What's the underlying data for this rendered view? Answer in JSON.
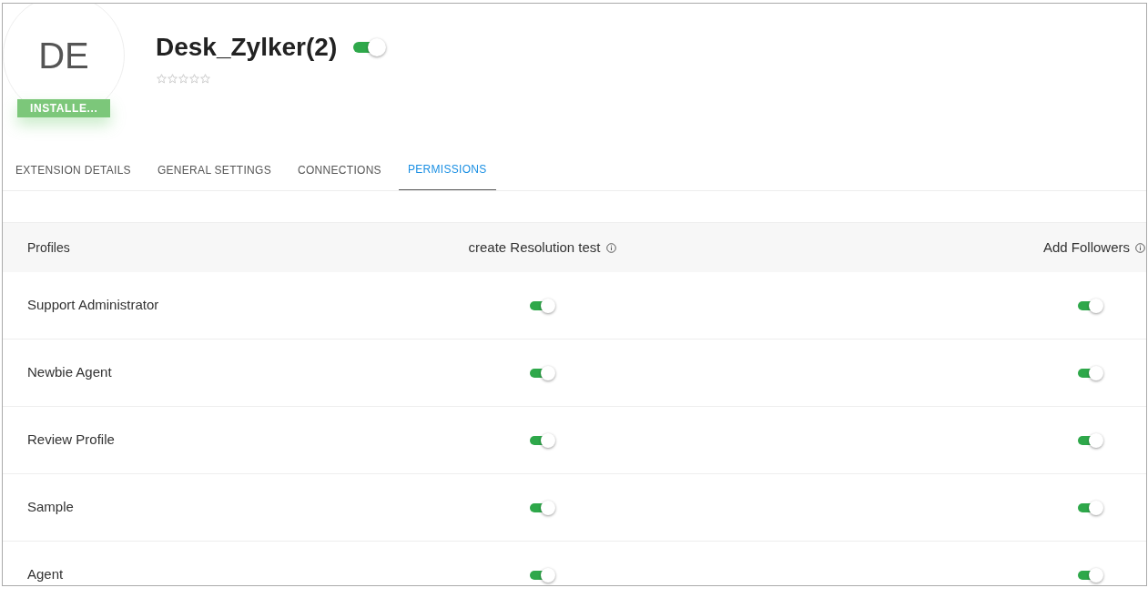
{
  "extension": {
    "initials": "DE",
    "ribbon": "INSTALLE...",
    "name": "Desk_Zylker(2)",
    "enabled": true,
    "stars": 0
  },
  "tabs": [
    {
      "label": "EXTENSION DETAILS",
      "selected": false
    },
    {
      "label": "GENERAL SETTINGS",
      "selected": false
    },
    {
      "label": "CONNECTIONS",
      "selected": false
    },
    {
      "label": "PERMISSIONS",
      "selected": true
    }
  ],
  "table": {
    "columns": [
      "Profiles",
      "create Resolution test",
      "Add Followers"
    ],
    "rows": [
      {
        "profile": "Support Administrator",
        "permissions": [
          true,
          true
        ]
      },
      {
        "profile": "Newbie Agent",
        "permissions": [
          true,
          true
        ]
      },
      {
        "profile": "Review Profile",
        "permissions": [
          true,
          true
        ]
      },
      {
        "profile": "Sample",
        "permissions": [
          true,
          true
        ]
      },
      {
        "profile": "Agent",
        "permissions": [
          true,
          true
        ]
      }
    ]
  }
}
